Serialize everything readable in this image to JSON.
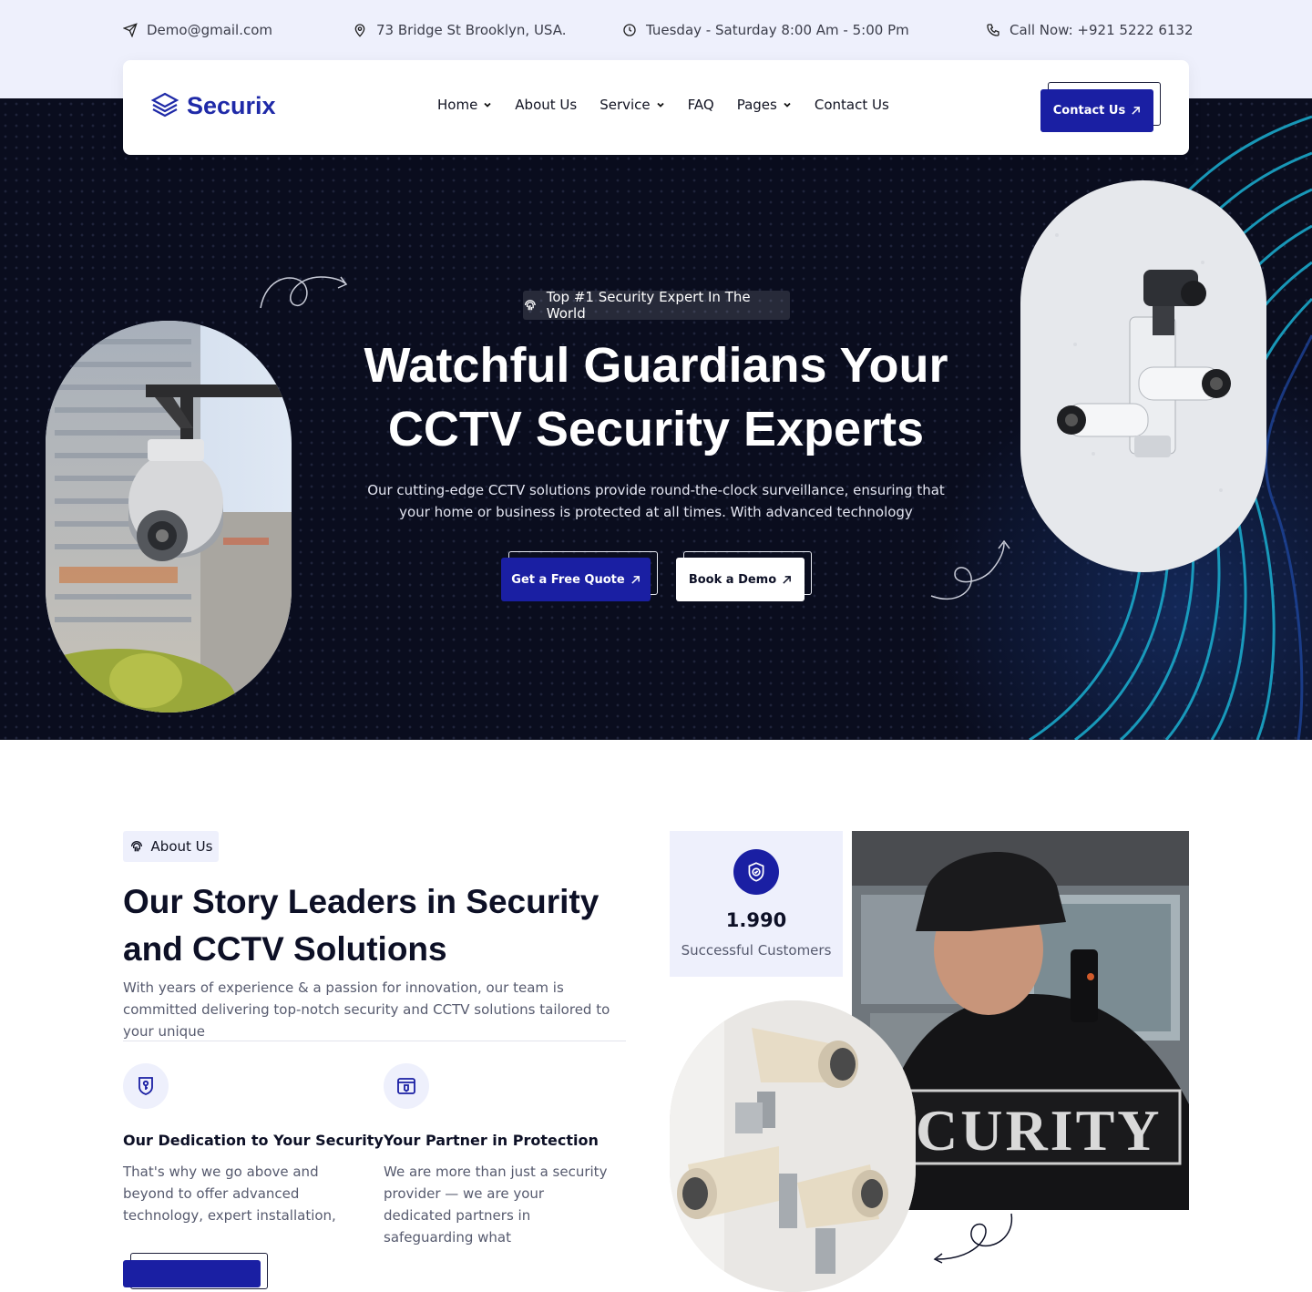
{
  "topbar": {
    "email": "Demo@gmail.com",
    "address": "73 Bridge St Brooklyn, USA.",
    "hours": "Tuesday - Saturday 8:00 Am - 5:00 Pm",
    "phone": "Call Now: +921 5222 6132"
  },
  "header": {
    "logo_text": "Securix",
    "nav": [
      "Home",
      "About Us",
      "Service",
      "FAQ",
      "Pages",
      "Contact Us"
    ],
    "cta_label": "Contact Us"
  },
  "hero": {
    "badge": "Top #1 Security Expert In The World",
    "title_line1": "Watchful Guardians Your",
    "title_line2": "CCTV Security Experts",
    "subtitle": "Our cutting-edge CCTV solutions provide round-the-clock surveillance, ensuring that your home or business is protected at all times. With advanced technology",
    "primary_btn": "Get a Free Quote",
    "secondary_btn": "Book a Demo"
  },
  "about": {
    "tag": "About Us",
    "title": "Our Story Leaders in Security and CCTV Solutions",
    "text": "With years of experience & a passion for innovation, our team is committed delivering top-notch security and CCTV solutions tailored to your unique",
    "features": [
      {
        "title": "Our Dedication to Your Security",
        "text": "That's why we go above and beyond to offer advanced technology, expert installation,",
        "icon": "shield-key-icon"
      },
      {
        "title": "Your Partner in Protection",
        "text": "We are more than just a security provider — we are your dedicated partners in safeguarding what",
        "icon": "security-browser-icon"
      }
    ],
    "stat": {
      "value": "1.990",
      "label": "Successful Customers",
      "icon": "shield-check-icon"
    },
    "guard_image_text": "CURITY"
  },
  "colors": {
    "brand_blue": "#1a1fa3",
    "hero_bg": "#0a0d1e",
    "topbar_bg": "#eef0fc"
  }
}
